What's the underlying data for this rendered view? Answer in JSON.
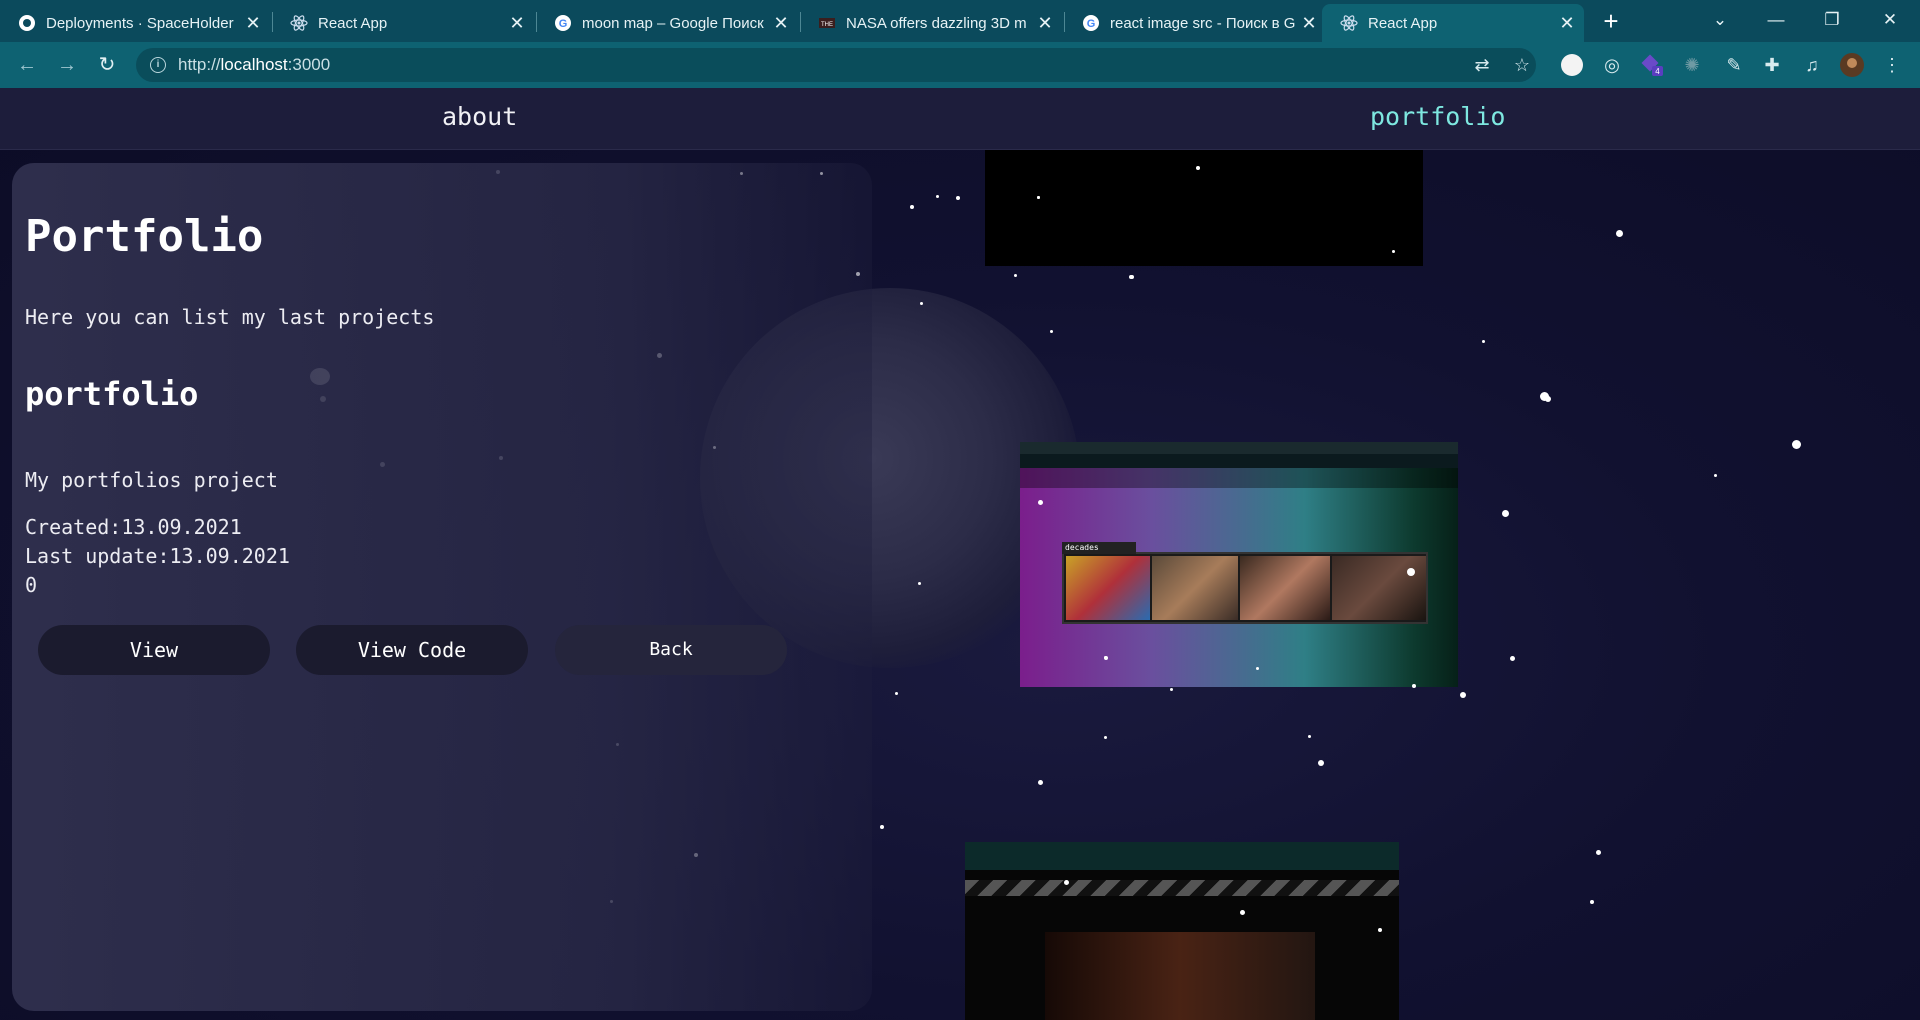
{
  "browser": {
    "tabs": [
      {
        "title": "Deployments · SpaceHolder",
        "icon": "github-icon"
      },
      {
        "title": "React App",
        "icon": "react-icon"
      },
      {
        "title": "moon map – Google Поиск",
        "icon": "google-icon"
      },
      {
        "title": "NASA offers dazzling 3D m",
        "icon": "news-icon"
      },
      {
        "title": "react image src - Поиск в G",
        "icon": "google-icon"
      },
      {
        "title": "React App",
        "icon": "react-icon",
        "active": true
      }
    ],
    "url_host": "localhost",
    "url_port": ":3000",
    "url_scheme": "http://",
    "extension_badge": "4"
  },
  "site": {
    "nav": {
      "about": "about",
      "portfolio": "portfolio"
    },
    "page_title": "Portfolio",
    "page_subtitle": "Here you can list my last projects",
    "project": {
      "name": "portfolio",
      "description": "My portfolios project",
      "created": "Created:13.09.2021",
      "updated": "Last update:13.09.2021",
      "count": "0"
    },
    "buttons": {
      "view": "View",
      "view_code": "View Code",
      "back": "Back"
    },
    "preview_window_title": "decades"
  },
  "colors": {
    "chrome_tabstrip": "#0b4a5c",
    "chrome_toolbar": "#0e6272",
    "nav_bg": "#1d1d3b",
    "accent": "#7ee8e0",
    "page_bg": "#0d0d24"
  }
}
